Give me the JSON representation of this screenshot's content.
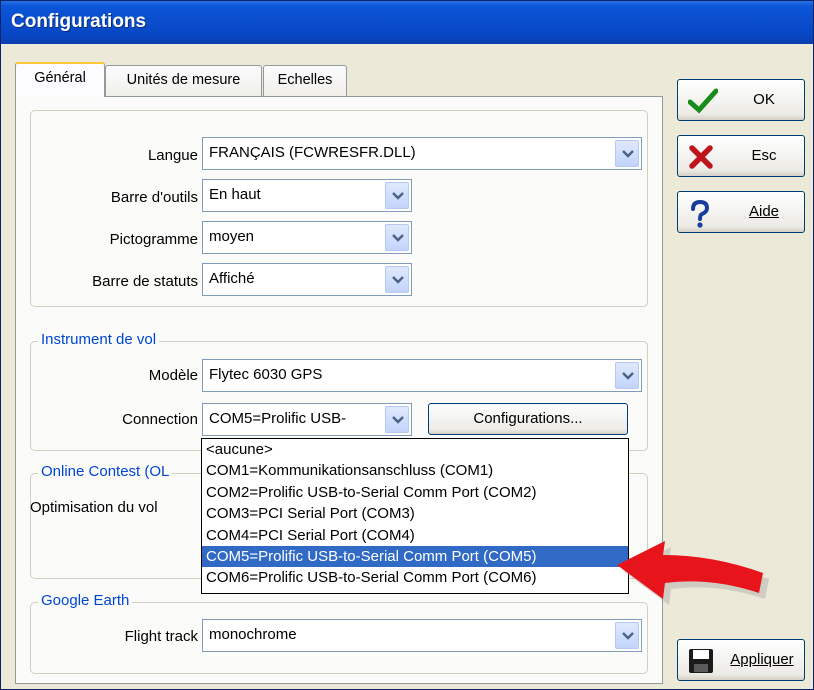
{
  "window": {
    "title": "Configurations"
  },
  "tabs": [
    {
      "label": "Général"
    },
    {
      "label": "Unités de mesure"
    },
    {
      "label": "Echelles"
    }
  ],
  "general": {
    "langue": {
      "label": "Langue",
      "value": "FRANÇAIS  (FCWRESFR.DLL)"
    },
    "barre_outils": {
      "label": "Barre d'outils",
      "value": "En haut"
    },
    "pictogramme": {
      "label": "Pictogramme",
      "value": "moyen"
    },
    "barre_statuts": {
      "label": "Barre de statuts",
      "value": "Affiché"
    }
  },
  "instrument": {
    "group_title": "Instrument de vol",
    "modele": {
      "label": "Modèle",
      "value": "Flytec 6030 GPS"
    },
    "connection": {
      "label": "Connection",
      "value": "COM5=Prolific USB-"
    },
    "config_button": "Configurations..."
  },
  "online_contest": {
    "group_title": "Online Contest (OL",
    "optimisation_label": "Optimisation du vol"
  },
  "connection_dropdown": {
    "options": [
      "<aucune>",
      "COM1=Kommunikationsanschluss (COM1)",
      "COM2=Prolific USB-to-Serial Comm Port (COM2)",
      "COM3=PCI Serial Port (COM3)",
      "COM4=PCI Serial Port (COM4)",
      "COM5=Prolific USB-to-Serial Comm Port (COM5)",
      "COM6=Prolific USB-to-Serial Comm Port (COM6)"
    ],
    "selected_index": 5
  },
  "google_earth": {
    "group_title": "Google Earth",
    "flight_track": {
      "label": "Flight track",
      "value": "monochrome"
    }
  },
  "buttons": {
    "ok": "OK",
    "esc": "Esc",
    "aide": "Aide",
    "appliquer": "Appliquer"
  },
  "colors": {
    "titlebar": "#0a4fd0",
    "selection": "#316ac5",
    "group_title": "#0046d5",
    "arrow_annotation": "#e8141c"
  }
}
